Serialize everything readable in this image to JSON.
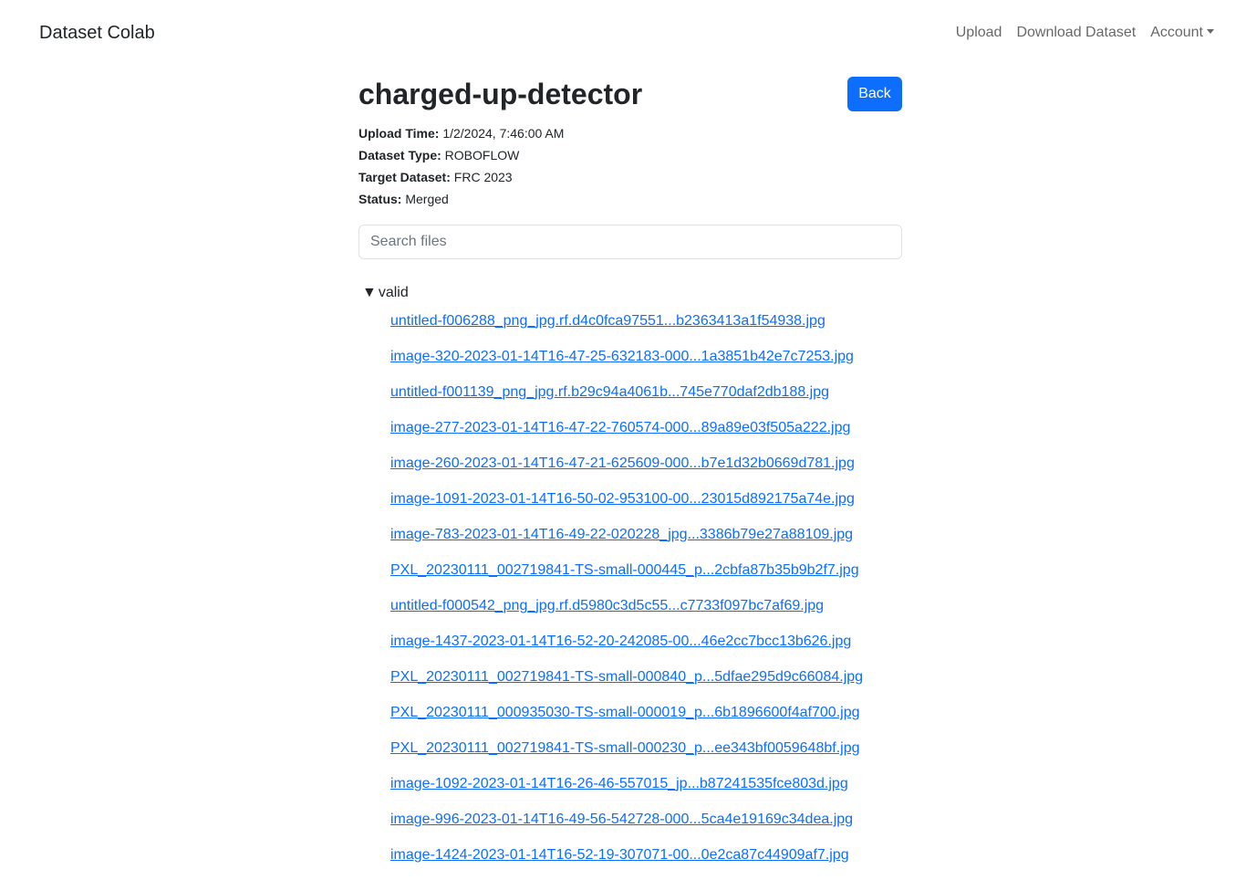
{
  "navbar": {
    "brand": "Dataset Colab",
    "links": [
      "Upload",
      "Download Dataset",
      "Account"
    ]
  },
  "dataset": {
    "title": "charged-up-detector",
    "back_label": "Back",
    "meta": [
      {
        "key": "Upload Time:",
        "value": "1/2/2024, 7:46:00 AM"
      },
      {
        "key": "Dataset Type:",
        "value": "ROBOFLOW"
      },
      {
        "key": "Target Dataset:",
        "value": "FRC 2023"
      },
      {
        "key": "Status:",
        "value": "Merged"
      }
    ]
  },
  "search": {
    "placeholder": "Search files",
    "value": ""
  },
  "tree": {
    "folder_toggle": "▼",
    "folder_name": "valid",
    "files": [
      "untitled-f006288_png_jpg.rf.d4c0fca97551...b2363413a1f54938.jpg",
      "image-320-2023-01-14T16-47-25-632183-000...1a3851b42e7c7253.jpg",
      "untitled-f001139_png_jpg.rf.b29c94a4061b...745e770daf2db188.jpg",
      "image-277-2023-01-14T16-47-22-760574-000...89a89e03f505a222.jpg",
      "image-260-2023-01-14T16-47-21-625609-000...b7e1d32b0669d781.jpg",
      "image-1091-2023-01-14T16-50-02-953100-00...23015d892175a74e.jpg",
      "image-783-2023-01-14T16-49-22-020228_jpg...3386b79e27a88109.jpg",
      "PXL_20230111_002719841-TS-small-000445_p...2cbfa87b35b9b2f7.jpg",
      "untitled-f000542_png_jpg.rf.d5980c3d5c55...c7733f097bc7af69.jpg",
      "image-1437-2023-01-14T16-52-20-242085-00...46e2cc7bcc13b626.jpg",
      "PXL_20230111_002719841-TS-small-000840_p...5dfae295d9c66084.jpg",
      "PXL_20230111_000935030-TS-small-000019_p...6b1896600f4af700.jpg",
      "PXL_20230111_002719841-TS-small-000230_p...ee343bf0059648bf.jpg",
      "image-1092-2023-01-14T16-26-46-557015_jp...b87241535fce803d.jpg",
      "image-996-2023-01-14T16-49-56-542728-000...5ca4e19169c34dea.jpg",
      "image-1424-2023-01-14T16-52-19-307071-00...0e2ca87c44909af7.jpg"
    ]
  }
}
